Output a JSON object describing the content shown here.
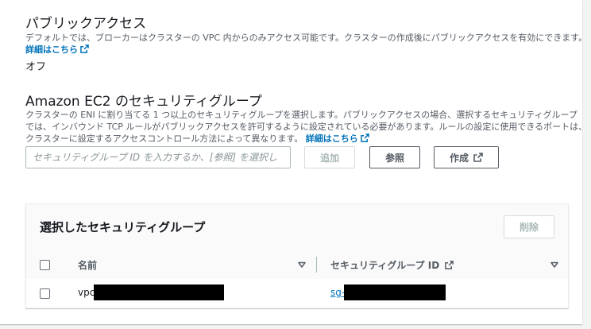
{
  "public_access": {
    "title": "パブリックアクセス",
    "description": "デフォルトでは、ブローカーはクラスターの VPC 内からのみアクセス可能です。クラスターの作成後にパブリックアクセスを有効にできます。",
    "learn_more": "詳細はこちら",
    "value": "オフ"
  },
  "security_groups": {
    "title": "Amazon EC2 のセキュリティグループ",
    "description_lines": [
      "クラスターの ENI に割り当てる 1 つ以上のセキュリティグループを選択します。パブリックアクセスの場合、選択するセキュリティグループ",
      "では、インバウンド TCP ルールがパブリックアクセスを許可するように設定されている必要があります。ルールの設定に使用できるポートは、",
      "クラスターに設定するアクセスコントロール方法によって異なります。"
    ],
    "learn_more": "詳細はこちら",
    "input_placeholder": "セキュリティグループ ID を入力するか、[参照] を選択し",
    "add_button": "追加",
    "browse_button": "参照",
    "create_button": "作成"
  },
  "selected_table": {
    "title": "選択したセキュリティグループ",
    "remove_button": "削除",
    "columns": [
      "名前",
      "セキュリティグループ ID"
    ],
    "rows": [
      {
        "name": "vpc",
        "group_id": "sg-"
      }
    ]
  },
  "colors": {
    "link": "#0073bb",
    "text_primary": "#16191f",
    "text_secondary": "#545b64",
    "border": "#aab7b8",
    "background": "#f2f3f3"
  },
  "icons": [
    "external-link-icon",
    "sort-caret-down-icon"
  ]
}
